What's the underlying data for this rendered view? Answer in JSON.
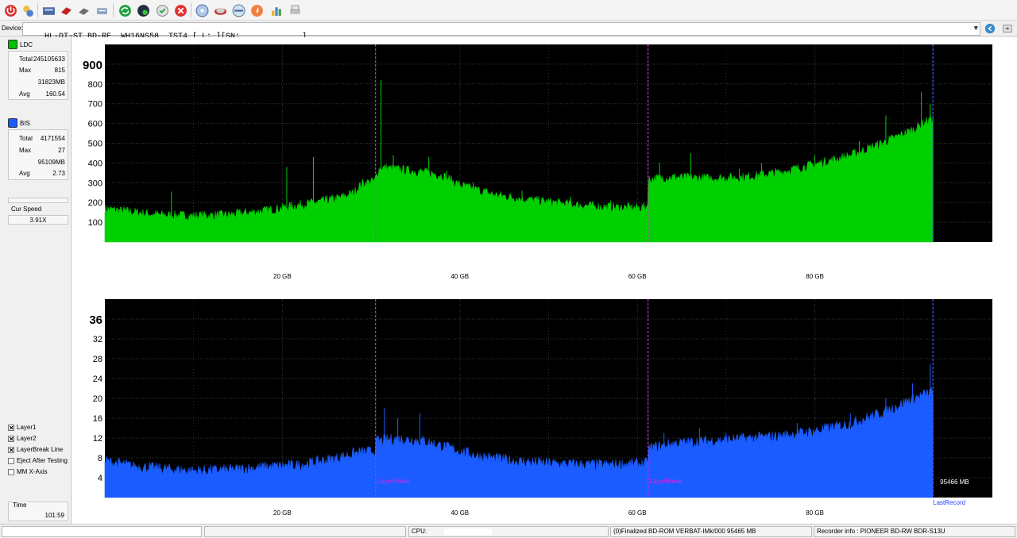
{
  "device": {
    "label": "Device:",
    "value": "HL-DT-ST BD-RE  WH16NS58  TST4 [ L: ][SN:             ]"
  },
  "ldc": {
    "label": "LDC",
    "color": "#00c000",
    "stats": [
      {
        "k": "Total",
        "v": "245105633"
      },
      {
        "k": "Max",
        "v": "815"
      },
      {
        "k": "",
        "v": "31823MB"
      },
      {
        "k": "Avg",
        "v": "160.54"
      }
    ]
  },
  "bis": {
    "label": "BIS",
    "color": "#1a5cff",
    "stats": [
      {
        "k": "Total",
        "v": "4171554"
      },
      {
        "k": "Max",
        "v": "27"
      },
      {
        "k": "",
        "v": "95109MB"
      },
      {
        "k": "Avg",
        "v": "2.73"
      }
    ]
  },
  "speed": {
    "label": "Cur Speed",
    "value": "3.91X"
  },
  "options": [
    {
      "label": "Layer1",
      "checked": true
    },
    {
      "label": "Layer2",
      "checked": true
    },
    {
      "label": "LayerBreak Line",
      "checked": true
    },
    {
      "label": "Eject After Testing",
      "checked": false
    },
    {
      "label": "MM X-Axis",
      "checked": false
    }
  ],
  "time": {
    "label": "Time",
    "value": "101:59"
  },
  "toolbar_icons": [
    "power-icon",
    "settings-icon",
    "drive-icon",
    "erase-icon",
    "burn-icon",
    "transfer-icon",
    "refresh-icon",
    "globe-icon",
    "disc-check-icon",
    "stop-icon",
    "disc-icon",
    "disc-scan-icon",
    "disc-info-icon",
    "fire-icon",
    "chart-icon",
    "print-icon"
  ],
  "status": {
    "cpu_label": "CPU:",
    "disc_info": "(0)Finalized  BD-ROM  VERBAT-IMk/000  95465 MB",
    "recorder": "Recorder info : PIONEER        BD-RW   BDR-S13U"
  },
  "chart_data": [
    {
      "type": "area",
      "series": [
        {
          "name": "LDC",
          "color": "#00d000"
        }
      ],
      "ylim": [
        0,
        1000
      ],
      "yticks": [
        "100",
        "200",
        "300",
        "400",
        "500",
        "600",
        "700",
        "800",
        "900"
      ],
      "xlim": [
        0,
        100
      ],
      "xticks": [
        "20 GB",
        "40 GB",
        "60 GB",
        "80 GB"
      ],
      "xtick_values": [
        20,
        40,
        60,
        80
      ],
      "layer_breaks": [
        30.5,
        61.2
      ],
      "last_record": 93.3,
      "profile": [
        [
          0,
          160
        ],
        [
          2,
          150
        ],
        [
          4,
          140
        ],
        [
          6,
          130
        ],
        [
          10,
          125
        ],
        [
          14,
          130
        ],
        [
          18,
          150
        ],
        [
          22,
          180
        ],
        [
          26,
          210
        ],
        [
          28,
          240
        ],
        [
          29,
          290
        ],
        [
          30.4,
          300
        ],
        [
          30.6,
          330
        ],
        [
          31,
          370
        ],
        [
          33,
          360
        ],
        [
          36,
          345
        ],
        [
          38,
          330
        ],
        [
          40,
          280
        ],
        [
          44,
          230
        ],
        [
          48,
          205
        ],
        [
          52,
          185
        ],
        [
          56,
          170
        ],
        [
          60,
          165
        ],
        [
          61.1,
          170
        ],
        [
          61.3,
          310
        ],
        [
          64,
          320
        ],
        [
          68,
          315
        ],
        [
          72,
          320
        ],
        [
          76,
          345
        ],
        [
          80,
          385
        ],
        [
          84,
          430
        ],
        [
          88,
          500
        ],
        [
          91,
          560
        ],
        [
          93.3,
          620
        ]
      ],
      "spikes": [
        [
          7.5,
          255
        ],
        [
          20.5,
          380
        ],
        [
          23.5,
          430
        ],
        [
          31.1,
          820
        ],
        [
          32.5,
          440
        ],
        [
          36.5,
          430
        ],
        [
          38.5,
          360
        ],
        [
          41.5,
          300
        ],
        [
          47,
          260
        ],
        [
          52.5,
          230
        ],
        [
          57,
          210
        ],
        [
          62.5,
          400
        ],
        [
          66,
          450
        ],
        [
          71.5,
          370
        ],
        [
          74,
          400
        ],
        [
          80,
          440
        ],
        [
          85,
          510
        ],
        [
          88,
          640
        ],
        [
          92,
          760
        ],
        [
          93,
          700
        ]
      ]
    },
    {
      "type": "area",
      "series": [
        {
          "name": "BIS",
          "color": "#1a5cff"
        }
      ],
      "ylim": [
        0,
        40
      ],
      "yticks": [
        "4",
        "8",
        "12",
        "16",
        "20",
        "24",
        "28",
        "32",
        "36"
      ],
      "xlim": [
        0,
        100
      ],
      "xticks": [
        "20 GB",
        "40 GB",
        "60 GB",
        "80 GB"
      ],
      "xtick_values": [
        20,
        40,
        60,
        80
      ],
      "layer_breaks": [
        30.5,
        61.2
      ],
      "last_record": 93.3,
      "annotations": [
        "LayerBreak",
        "LayerBreak",
        "95466 MB",
        "LastRecord"
      ],
      "profile": [
        [
          0,
          7
        ],
        [
          3,
          6
        ],
        [
          6,
          5.5
        ],
        [
          10,
          5
        ],
        [
          14,
          5.2
        ],
        [
          18,
          5.8
        ],
        [
          22,
          6.2
        ],
        [
          26,
          7.5
        ],
        [
          28,
          8.5
        ],
        [
          30.4,
          9
        ],
        [
          30.6,
          11
        ],
        [
          33,
          11.5
        ],
        [
          36,
          11
        ],
        [
          39,
          9.5
        ],
        [
          42,
          8
        ],
        [
          46,
          7
        ],
        [
          50,
          6.5
        ],
        [
          56,
          6.2
        ],
        [
          61.1,
          6.5
        ],
        [
          61.3,
          9.5
        ],
        [
          64,
          10.5
        ],
        [
          68,
          11
        ],
        [
          72,
          11.5
        ],
        [
          76,
          12
        ],
        [
          80,
          13
        ],
        [
          84,
          14.5
        ],
        [
          88,
          17
        ],
        [
          91,
          19.5
        ],
        [
          93.3,
          21
        ]
      ],
      "spikes": [
        [
          31.5,
          18
        ],
        [
          33,
          16
        ],
        [
          35.5,
          17
        ],
        [
          63,
          13
        ],
        [
          67,
          14
        ],
        [
          70,
          13
        ],
        [
          78,
          15
        ],
        [
          84,
          17
        ],
        [
          88,
          20
        ],
        [
          91,
          23
        ],
        [
          93,
          27
        ]
      ]
    }
  ]
}
